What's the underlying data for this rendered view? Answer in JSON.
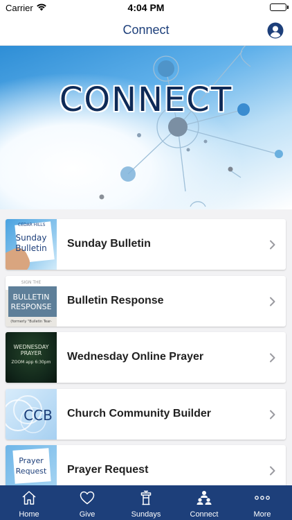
{
  "status_bar": {
    "carrier": "Carrier",
    "time": "4:04 PM"
  },
  "nav": {
    "title": "Connect"
  },
  "banner": {
    "headline": "CONNECT"
  },
  "list": [
    {
      "label": "Sunday Bulletin",
      "thumb_lines": [
        "Sunday",
        "Bulletin"
      ],
      "thumb_badge": "CEDAR HILLS"
    },
    {
      "label": "Bulletin Response",
      "thumb_lines": [
        "BULLETIN",
        "RESPONSE"
      ],
      "thumb_top": "SIGN THE",
      "thumb_note": "(formerly \"Bulletin Tear-"
    },
    {
      "label": "Wednesday Online Prayer",
      "thumb_lines": [
        "WEDNESDAY",
        "PRAYER"
      ],
      "thumb_note": "ZOOM app  6:30pm"
    },
    {
      "label": "Church Community Builder",
      "thumb_lines": [
        "CCB"
      ]
    },
    {
      "label": "Prayer Request",
      "thumb_lines": [
        "Prayer",
        "Request"
      ]
    }
  ],
  "tabs": [
    {
      "label": "Home",
      "icon": "home-icon"
    },
    {
      "label": "Give",
      "icon": "heart-icon"
    },
    {
      "label": "Sundays",
      "icon": "podium-icon"
    },
    {
      "label": "Connect",
      "icon": "people-icon"
    },
    {
      "label": "More",
      "icon": "ellipsis-icon"
    }
  ],
  "colors": {
    "brand": "#1d3f7a",
    "accent_blue": "#2e8ed6"
  }
}
